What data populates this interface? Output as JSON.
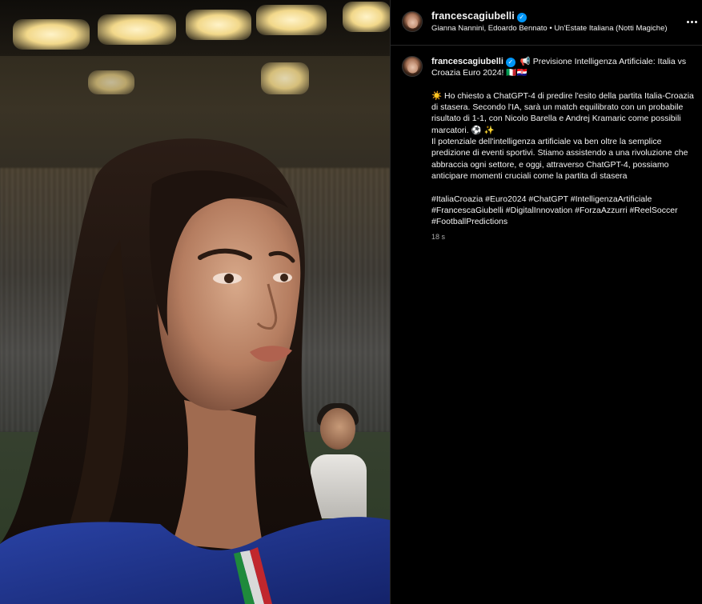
{
  "post": {
    "username": "francescagiubelli",
    "verified_badge": "✓",
    "music": "Gianna Nannini, Edoardo Bennato • Un'Estate Italiana (Notti Magiche)",
    "more_icon": "more-horizontal-icon"
  },
  "caption": {
    "username": "francescagiubelli",
    "verified_badge": "✓",
    "title": "📢  Previsione Intelligenza Artificiale: Italia vs Croazia Euro 2024! 🇮🇹🇭🇷",
    "paragraph_1": "☀️  Ho chiesto a ChatGPT-4 di predire l'esito della partita Italia-Croazia di stasera. Secondo l'IA, sarà un match equilibrato con un probabile risultato di 1-1, con Nicolo Barella e Andrej Kramaric come possibili marcatori. ⚽ ✨",
    "paragraph_2": "Il potenziale dell'intelligenza artificiale va ben oltre la semplice predizione di eventi sportivi. Stiamo assistendo a una rivoluzione che abbraccia ogni settore, e oggi, attraverso ChatGPT-4, possiamo anticipare momenti cruciali come la partita di stasera",
    "hashtags": "#ItaliaCroazia #Euro2024 #ChatGPT #IntelligenzaArtificiale #FrancescaGiubelli #DigitalInnovation #ForzaAzzurri #ReelSoccer #FootballPredictions",
    "timestamp": "18 s"
  },
  "colors": {
    "background": "#000000",
    "text": "#f5f5f5",
    "secondary_text": "#a8a8a8",
    "verified": "#0095f6",
    "divider": "#262626"
  }
}
